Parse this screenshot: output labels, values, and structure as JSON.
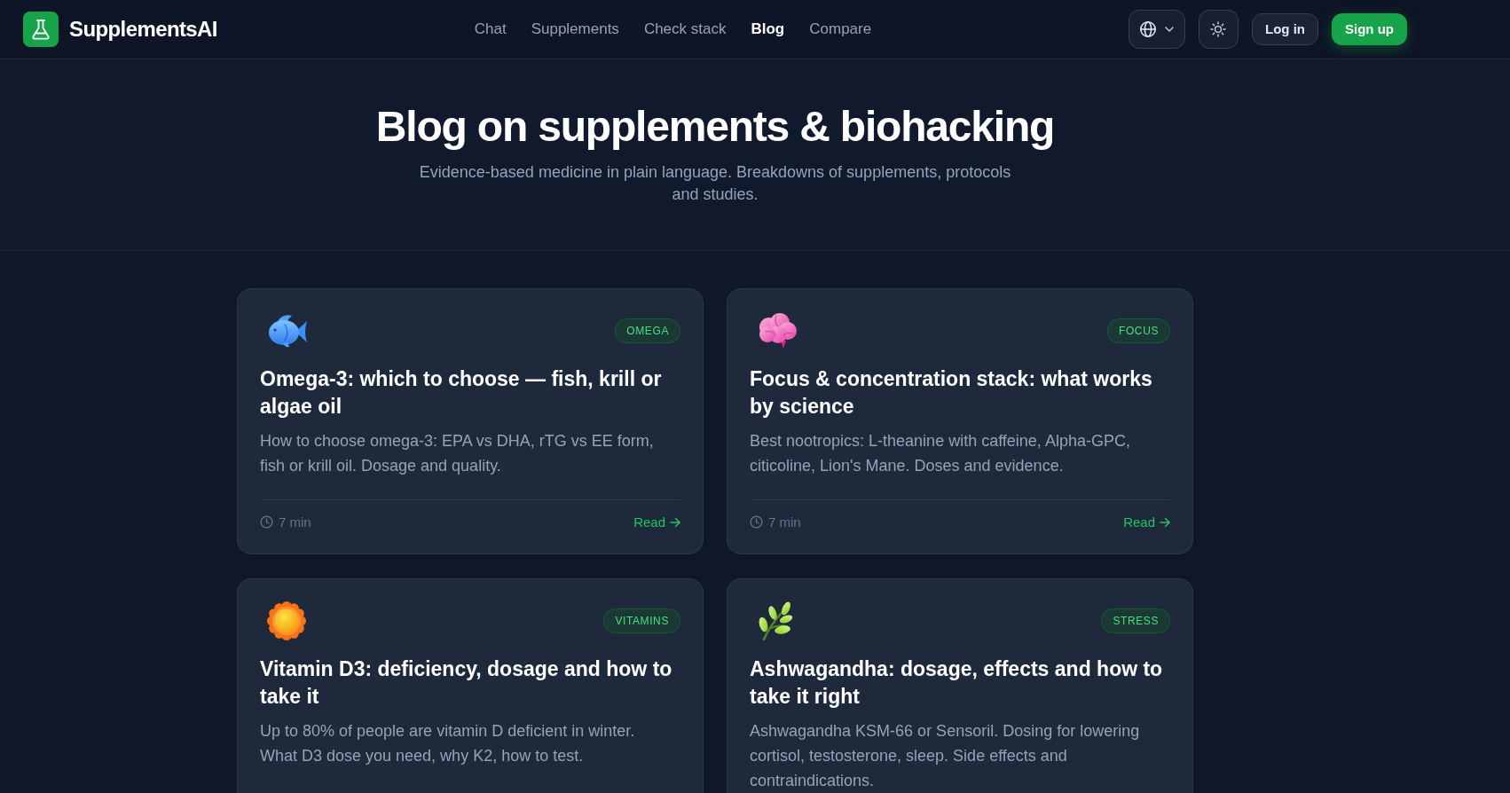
{
  "header": {
    "brand": "SupplementsAI",
    "nav": [
      {
        "label": "Chat",
        "selected": false
      },
      {
        "label": "Supplements",
        "selected": false
      },
      {
        "label": "Check stack",
        "selected": false
      },
      {
        "label": "Blog",
        "selected": true
      },
      {
        "label": "Compare",
        "selected": false
      }
    ],
    "login": "Log in",
    "signup": "Sign up"
  },
  "hero": {
    "title": "Blog on supplements & biohacking",
    "subtitle": "Evidence-based medicine in plain language. Breakdowns of supplements, protocols and studies."
  },
  "posts": [
    {
      "tag": "OMEGA",
      "title": "Omega-3: which to choose — fish, krill or algae oil",
      "excerpt": "How to choose omega-3: EPA vs DHA, rTG vs EE form, fish or krill oil. Dosage and quality.",
      "read_time": "7 min",
      "link": "Read"
    },
    {
      "tag": "FOCUS",
      "title": "Focus & concentration stack: what works by science",
      "excerpt": "Best nootropics: L-theanine with caffeine, Alpha-GPC, citicoline, Lion's Mane. Doses and evidence.",
      "read_time": "7 min",
      "link": "Read"
    },
    {
      "tag": "VITAMINS",
      "title": "Vitamin D3: deficiency, dosage and how to take it",
      "excerpt": "Up to 80% of people are vitamin D deficient in winter. What D3 dose you need, why K2, how to test."
    },
    {
      "tag": "STRESS",
      "title": "Ashwagandha: dosage, effects and how to take it right",
      "excerpt": "Ashwagandha KSM-66 or Sensoril. Dosing for lowering cortisol, testosterone, sleep. Side effects and contraindications."
    }
  ]
}
